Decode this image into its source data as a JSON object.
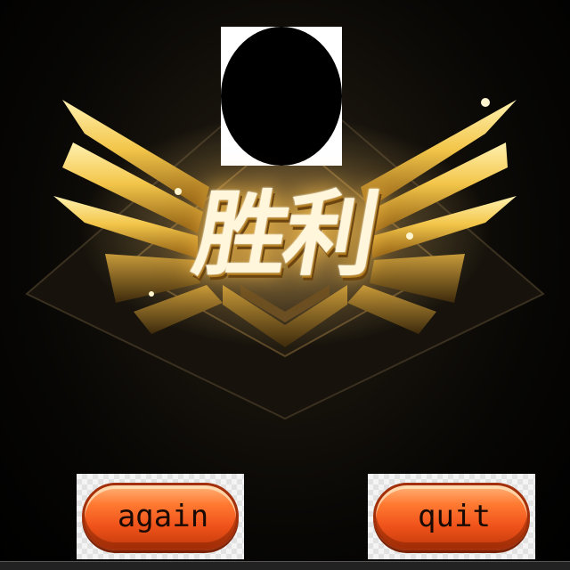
{
  "screen": {
    "title_text": "胜利",
    "background_color": "#000000",
    "accent_color": "#f3c64a"
  },
  "avatar": {
    "icon": "avatar-placeholder-icon"
  },
  "buttons": {
    "again_label": "again",
    "quit_label": "quit",
    "button_color": "#f0531a"
  }
}
